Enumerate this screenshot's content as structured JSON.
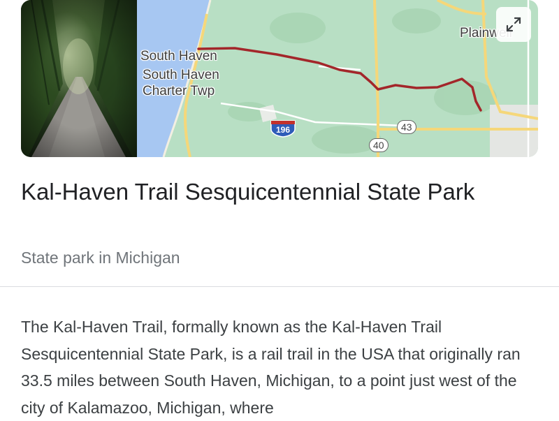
{
  "map": {
    "labels": {
      "south_haven": "South Haven",
      "charter_twp": "South Haven\nCharter Twp",
      "plainwell": "Plainwell",
      "route_196": "196",
      "route_43": "43",
      "route_40": "40"
    },
    "colors": {
      "land": "#b8dfc4",
      "water": "#a7c7f2",
      "trail": "#a3262a",
      "highway": "#f5d77a"
    }
  },
  "place": {
    "title": "Kal-Haven Trail Sesquicentennial State Park",
    "subtitle": "State park in Michigan"
  },
  "description": "The Kal-Haven Trail, formally known as the Kal-Haven Trail Sesquicentennial State Park, is a rail trail in the USA that originally ran 33.5 miles between South Haven, Michigan, to a point just west of the city of Kalamazoo, Michigan, where"
}
